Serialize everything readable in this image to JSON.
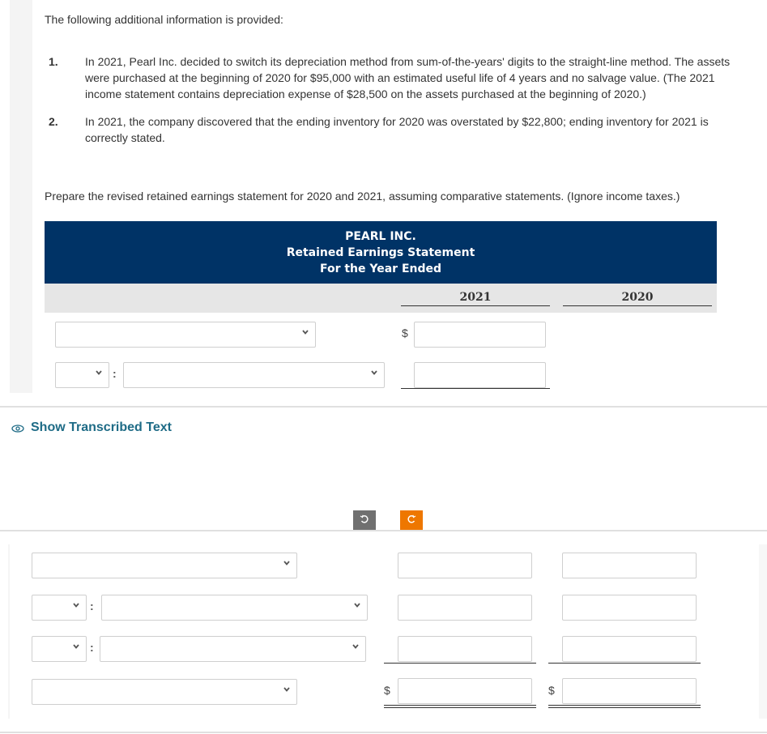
{
  "intro": "The following additional information is provided:",
  "info_items": [
    {
      "num": "1.",
      "text": "In 2021, Pearl Inc. decided to switch its depreciation method from sum-of-the-years' digits to the straight-line method. The assets were purchased at the beginning of 2020 for $95,000 with an estimated useful life of 4 years and no salvage value. (The 2021 income statement contains depreciation expense of $28,500 on the assets purchased at the beginning of 2020.)"
    },
    {
      "num": "2.",
      "text": "In 2021, the company discovered that the ending inventory for 2020 was overstated by $22,800; ending inventory for 2021 is correctly stated."
    }
  ],
  "instruction": "Prepare the revised retained earnings statement for 2020 and 2021, assuming comparative statements. (Ignore income taxes.)",
  "statement": {
    "company": "PEARL INC.",
    "title": "Retained Earnings Statement",
    "period": "For the Year Ended",
    "columns": [
      "2021",
      "2020"
    ]
  },
  "currency_symbol": "$",
  "colon": ":",
  "show_transcribed": "Show Transcribed Text",
  "toolbar": {
    "undo_icon": "undo-icon",
    "redo_icon": "redo-icon"
  },
  "colors": {
    "header_bg": "#003366",
    "link": "#1e6b86",
    "redo_button": "#ee7700",
    "undo_button": "#707070"
  },
  "top_form": {
    "rows": [
      {
        "type": "select-wide",
        "selected": "",
        "value_2021": ""
      },
      {
        "type": "select-pair",
        "selected_prefix": "",
        "selected": "",
        "value_2021": ""
      }
    ]
  },
  "bottom_form": {
    "rows": [
      {
        "type": "select-wide",
        "selected": "",
        "value_2021": "",
        "value_2020": ""
      },
      {
        "type": "select-pair",
        "selected_prefix": "",
        "selected": "",
        "value_2021": "",
        "value_2020": ""
      },
      {
        "type": "select-pair",
        "selected_prefix": "",
        "selected": "",
        "value_2021": "",
        "value_2020": ""
      },
      {
        "type": "select-wide",
        "selected": "",
        "value_2021": "",
        "value_2020": ""
      }
    ]
  }
}
